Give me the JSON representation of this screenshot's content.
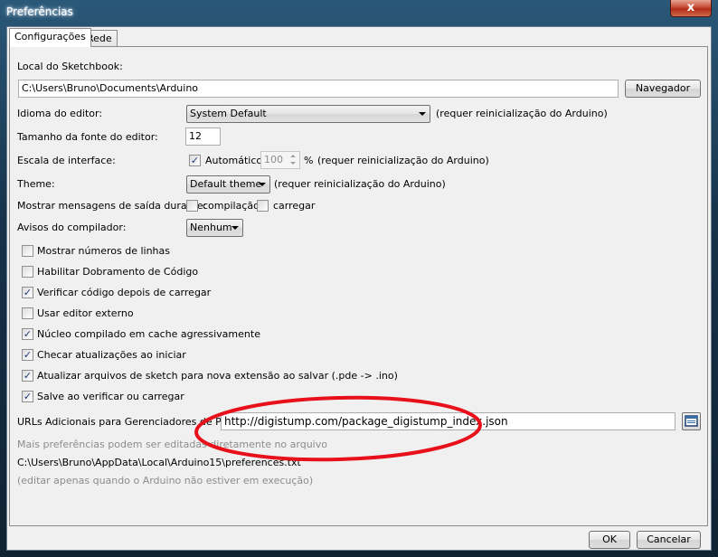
{
  "window": {
    "title": "Preferências",
    "close_label": "x"
  },
  "tabs": [
    {
      "label": "Configurações",
      "active": true
    },
    {
      "label": "Rede",
      "active": false
    }
  ],
  "sketchbook": {
    "label": "Local do Sketchbook:",
    "path": "C:\\Users\\Bruno\\Documents\\Arduino",
    "browse_label": "Navegador"
  },
  "language": {
    "label": "Idioma do editor:",
    "value": "System Default",
    "note": "(requer reinicialização do Arduino)"
  },
  "font_size": {
    "label": "Tamanho da fonte do editor:",
    "value": "12"
  },
  "scale": {
    "label": "Escala de interface:",
    "auto_label": "Automático",
    "auto_checked": true,
    "value": "100",
    "unit": "%",
    "note": "(requer reinicialização do Arduino)"
  },
  "theme": {
    "label": "Theme:",
    "value": "Default theme",
    "note": "(requer reinicialização do Arduino)"
  },
  "verbose": {
    "label": "Mostrar mensagens de saída durante:",
    "compile_label": "compilação",
    "compile_checked": false,
    "upload_label": "carregar",
    "upload_checked": false
  },
  "warnings": {
    "label": "Avisos do compilador:",
    "value": "Nenhum"
  },
  "options": [
    {
      "label": "Mostrar números de linhas",
      "checked": false
    },
    {
      "label": "Habilitar Dobramento de Código",
      "checked": false
    },
    {
      "label": "Verificar código depois de carregar",
      "checked": true
    },
    {
      "label": "Usar editor externo",
      "checked": false
    },
    {
      "label": "Núcleo compilado em cache agressivamente",
      "checked": true
    },
    {
      "label": "Checar atualizações ao iniciar",
      "checked": true
    },
    {
      "label": "Atualizar arquivos de sketch para nova extensão ao salvar (.pde -> .ino)",
      "checked": true
    },
    {
      "label": "Salve ao verificar ou carregar",
      "checked": true
    }
  ],
  "boards_url": {
    "label": "URLs Adicionais para Gerenciadores de Placas:",
    "value": "http://digistump.com/package_digistump_index.json",
    "icon": "window-list-icon"
  },
  "more_prefs": {
    "note": "Mais preferências podem ser editadas diretamente no arquivo",
    "path": "C:\\Users\\Bruno\\AppData\\Local\\Arduino15\\preferences.txt",
    "hint": "(editar apenas quando o Arduino não estiver em execução)"
  },
  "buttons": {
    "ok": "OK",
    "cancel": "Cancelar"
  },
  "colors": {
    "highlight_ellipse": "#e8101a",
    "check_mark": "#1e3a7a"
  }
}
